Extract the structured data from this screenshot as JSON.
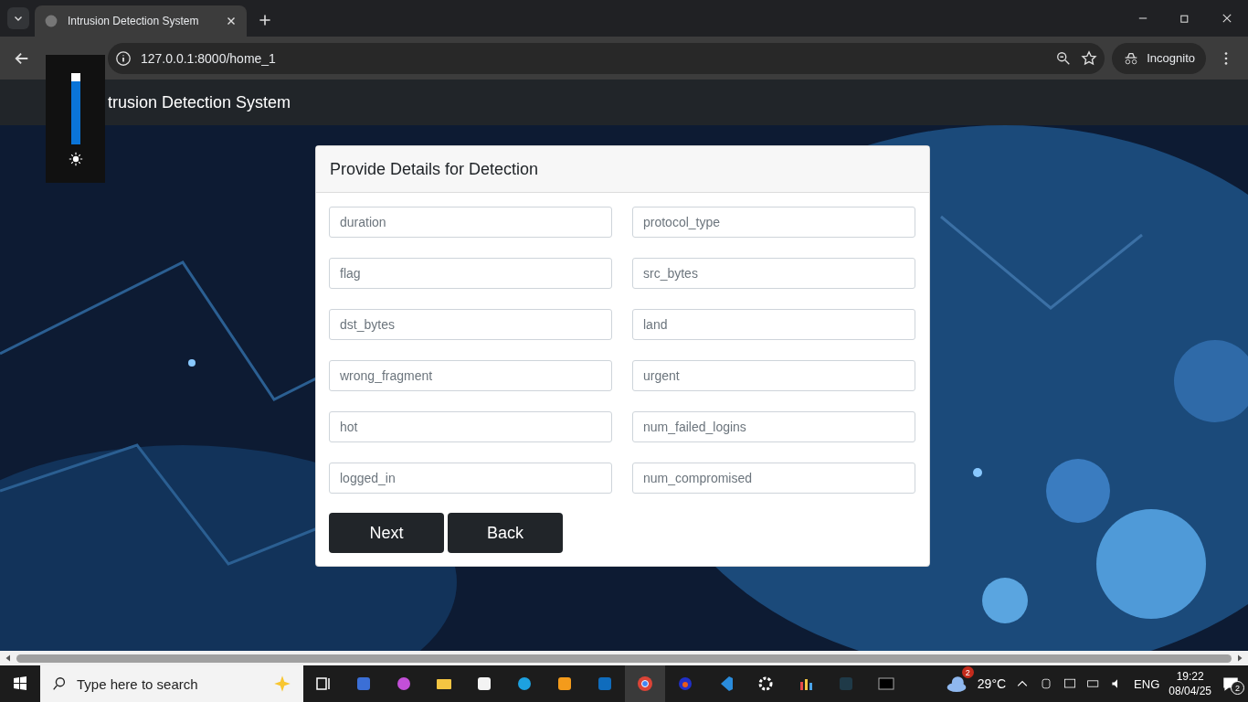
{
  "browser": {
    "tab_title": "Intrusion Detection System",
    "url": "127.0.0.1:8000/home_1",
    "profile": "Incognito"
  },
  "brightness": {
    "level": 0.88
  },
  "navbar": {
    "brand": "trusion Detection System"
  },
  "card": {
    "title": "Provide Details for Detection",
    "fields": [
      {
        "placeholder": "duration"
      },
      {
        "placeholder": "protocol_type"
      },
      {
        "placeholder": "flag"
      },
      {
        "placeholder": "src_bytes"
      },
      {
        "placeholder": "dst_bytes"
      },
      {
        "placeholder": "land"
      },
      {
        "placeholder": "wrong_fragment"
      },
      {
        "placeholder": "urgent"
      },
      {
        "placeholder": "hot"
      },
      {
        "placeholder": "num_failed_logins"
      },
      {
        "placeholder": "logged_in"
      },
      {
        "placeholder": "num_compromised"
      }
    ],
    "buttons": [
      "Next",
      "Back"
    ]
  },
  "taskbar": {
    "search_placeholder": "Type here to search",
    "weather_badge": "2",
    "temperature": "29°C",
    "language": "ENG",
    "time": "19:22",
    "date": "08/04/25",
    "notification_count": "2"
  }
}
